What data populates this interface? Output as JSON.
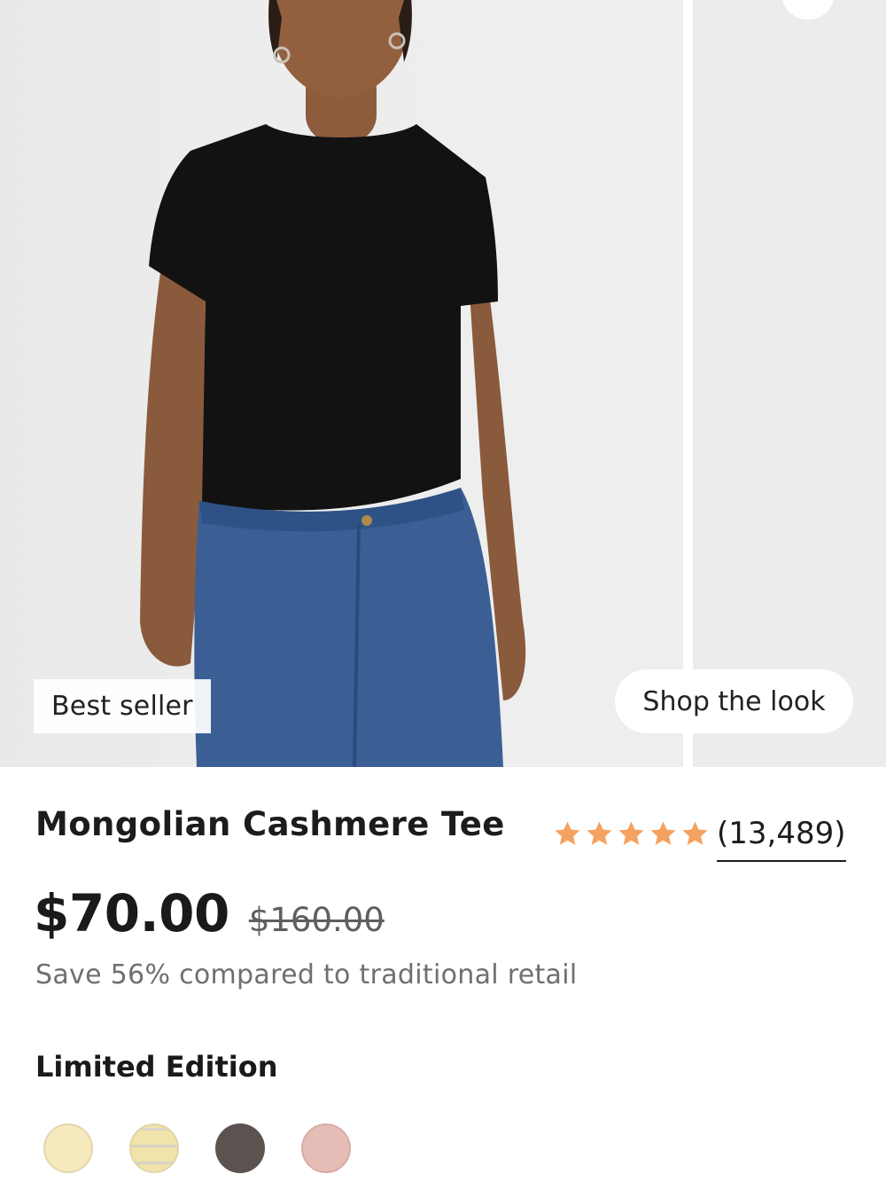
{
  "gallery": {
    "badge": "Best seller",
    "shop_look_button": "Shop the look"
  },
  "product": {
    "title": "Mongolian Cashmere Tee",
    "rating": {
      "stars": 5,
      "review_count": "(13,489)",
      "star_color": "#f4a261"
    },
    "price": {
      "current": "$70.00",
      "original": "$160.00"
    },
    "savings_note": "Save 56% compared to traditional retail",
    "edition": {
      "label": "Limited Edition",
      "swatches": [
        {
          "name": "cream",
          "color": "#f6e9bd"
        },
        {
          "name": "cream-stripe",
          "color": "#f1e3a9"
        },
        {
          "name": "charcoal",
          "color": "#5b534f"
        },
        {
          "name": "blush",
          "color": "#e6bdb6"
        }
      ]
    }
  }
}
